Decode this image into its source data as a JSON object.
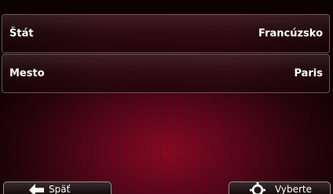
{
  "form": {
    "country_label": "Štát",
    "country_value": "Francúzsko",
    "city_label": "Mesto",
    "city_value": "Paris"
  },
  "bottom_bar": {
    "back_label": "Späť",
    "back_icon": "arrow-left-icon",
    "select_label": "Vyberte",
    "select_icon": "crosshair-icon"
  },
  "colors": {
    "background_accent": "#8a0a22",
    "row_border": "#6e5055",
    "text": "#ffffff"
  }
}
